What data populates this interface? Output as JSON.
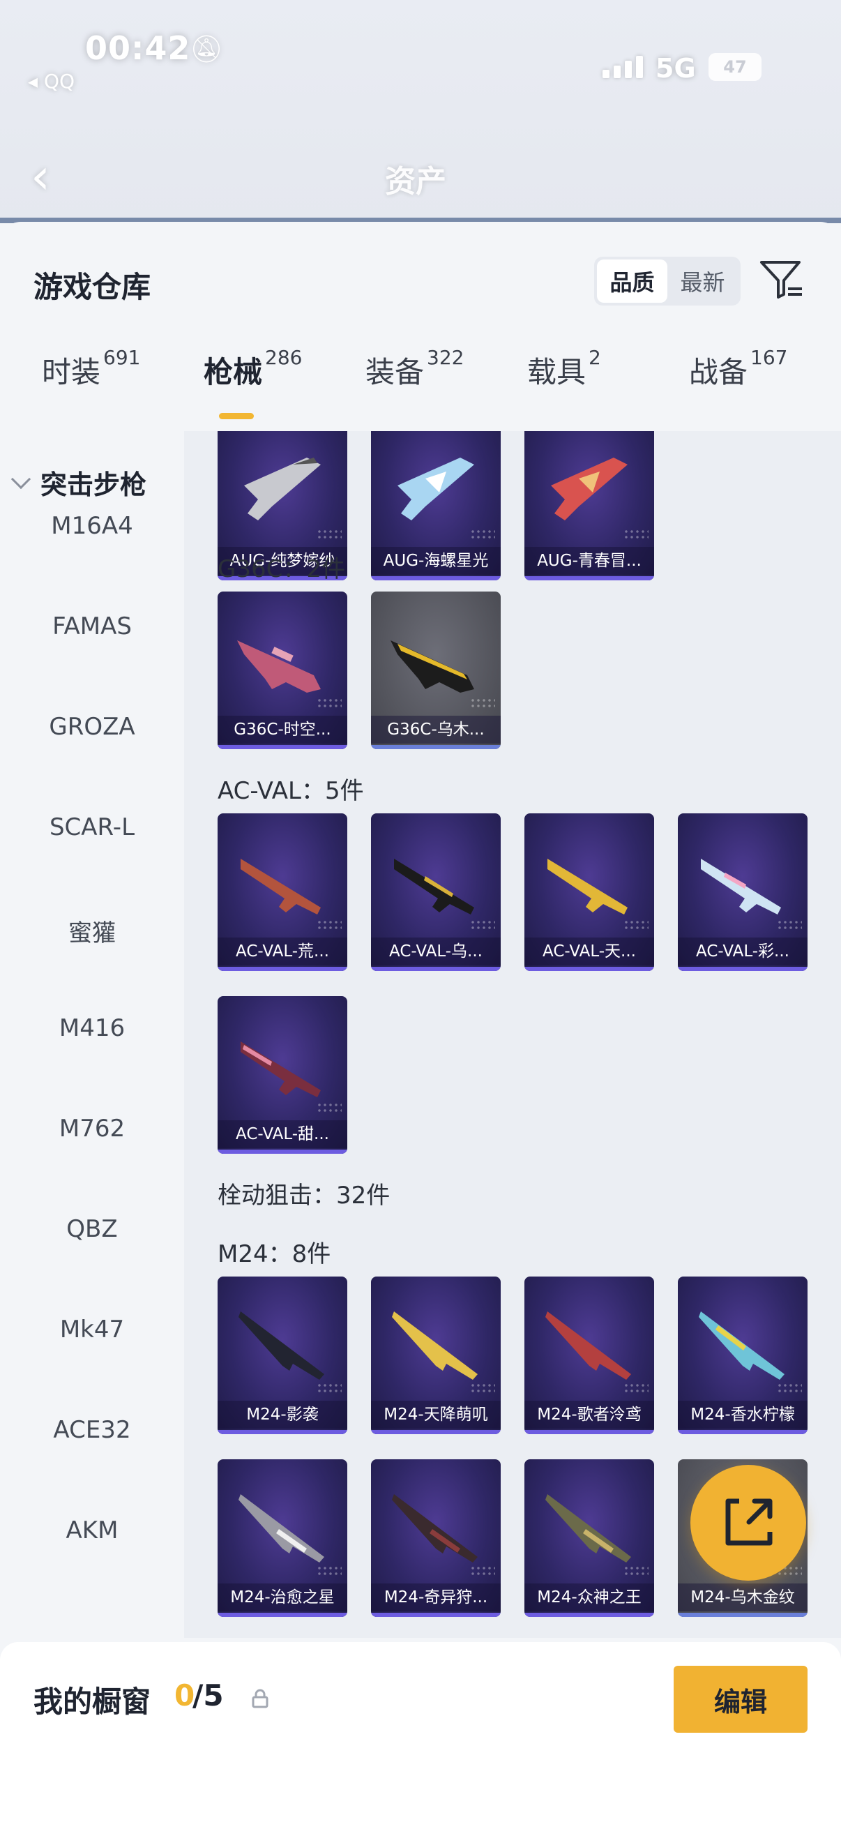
{
  "status_bar": {
    "time": "00:42",
    "back_app": "◂ QQ",
    "network": "5G",
    "battery": "47"
  },
  "nav": {
    "title": "资产"
  },
  "sheet": {
    "title": "游戏仓库",
    "sort": [
      "品质",
      "最新"
    ],
    "sort_active": "品质"
  },
  "tabs": [
    {
      "label": "时装",
      "count": "691"
    },
    {
      "label": "枪械",
      "count": "286",
      "active": true
    },
    {
      "label": "装备",
      "count": "322"
    },
    {
      "label": "载具",
      "count": "2"
    },
    {
      "label": "战备",
      "count": "167"
    }
  ],
  "sidebar": {
    "group": "突击步枪",
    "items": [
      "M16A4",
      "FAMAS",
      "GROZA",
      "SCAR-L",
      "蜜獾",
      "M416",
      "M762",
      "QBZ",
      "Mk47",
      "ACE32",
      "AKM"
    ]
  },
  "sections": {
    "aug": {
      "cards": [
        "AUG-纯梦嫁纱",
        "AUG-海螺星光",
        "AUG-青春冒..."
      ]
    },
    "g36c": {
      "label": "G36C：2件",
      "cards": [
        "G36C-时空...",
        "G36C-乌木..."
      ]
    },
    "acval": {
      "label": "AC-VAL：5件",
      "cards": [
        "AC-VAL-荒...",
        "AC-VAL-乌...",
        "AC-VAL-天...",
        "AC-VAL-彩...",
        "AC-VAL-甜..."
      ]
    },
    "bolt": {
      "label": "栓动狙击：32件"
    },
    "m24": {
      "label": "M24：8件",
      "cards": [
        "M24-影袭",
        "M24-天降萌叽",
        "M24-歌者泠鸢",
        "M24-香水柠檬",
        "M24-治愈之星",
        "M24-奇异狩...",
        "M24-众神之王",
        "M24-乌木金纹"
      ]
    }
  },
  "bottom": {
    "title": "我的橱窗",
    "count_current": "0",
    "count_rest": "/5",
    "edit_label": "编辑"
  },
  "colors": {
    "accent": "#f1b232",
    "card_purple": "#2f2766"
  }
}
